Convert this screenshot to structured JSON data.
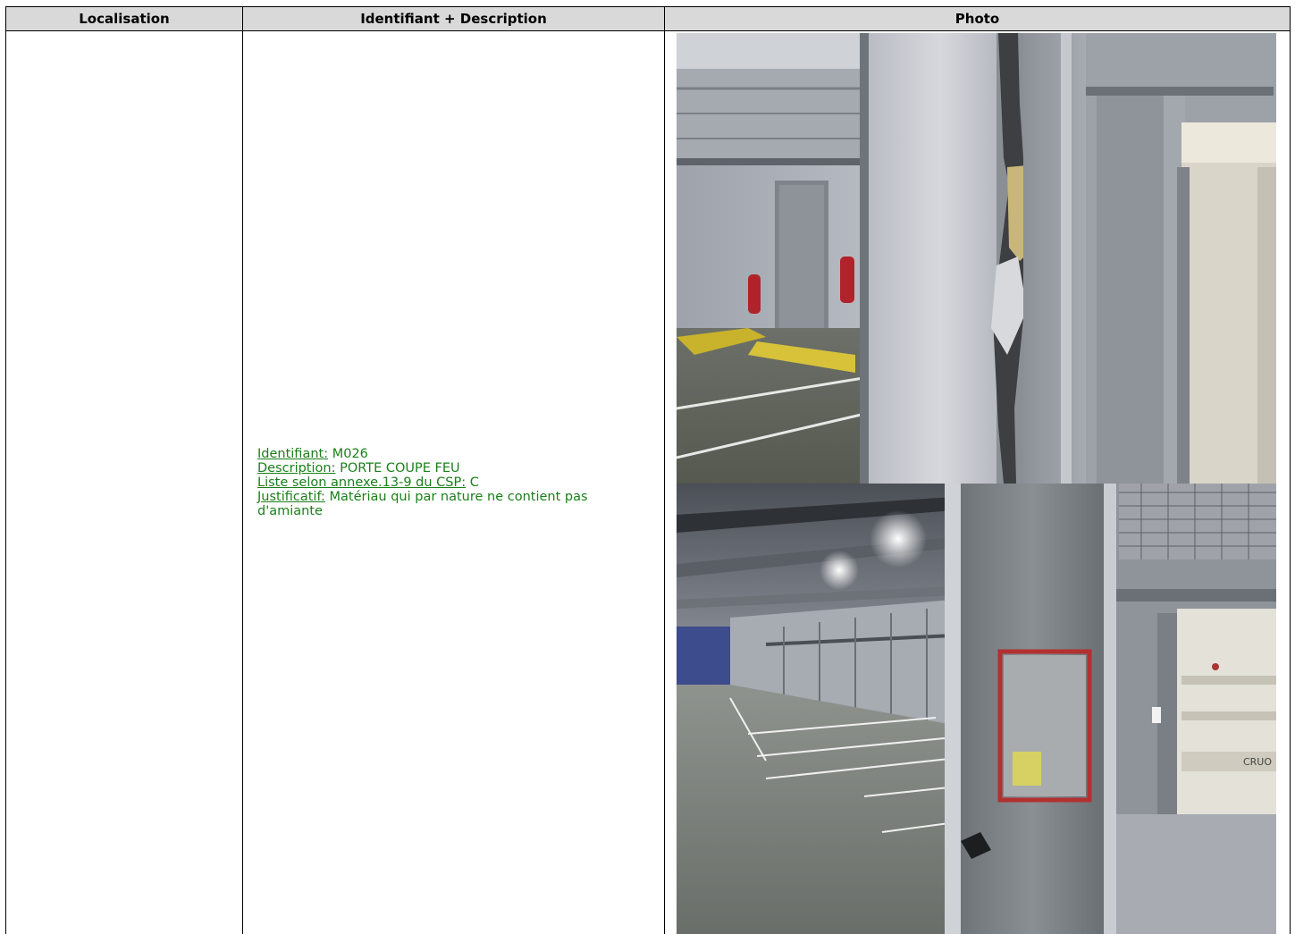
{
  "table": {
    "headers": {
      "localisation": "Localisation",
      "identifiant": "Identifiant + Description",
      "photo": "Photo"
    },
    "rows": [
      {
        "localisation": "",
        "identifiant_label": "Identifiant:",
        "identifiant_value": "M026",
        "description_label": "Description:",
        "description_value": "PORTE COUPE FEU",
        "liste_label": "Liste selon annexe.13-9 du CSP:",
        "liste_value": "C",
        "justificatif_label": "Justificatif:",
        "justificatif_value": "Matériau qui par nature ne contient pas d'amiante",
        "photos": [
          {
            "name": "door-frame-closeup",
            "sign_text": ""
          },
          {
            "name": "parking-fire-door-view",
            "sign_text": "CRUO"
          }
        ]
      }
    ]
  },
  "colors": {
    "header_bg": "#d9d9d9",
    "description_text": "#1a7f1a",
    "border": "#000000"
  }
}
